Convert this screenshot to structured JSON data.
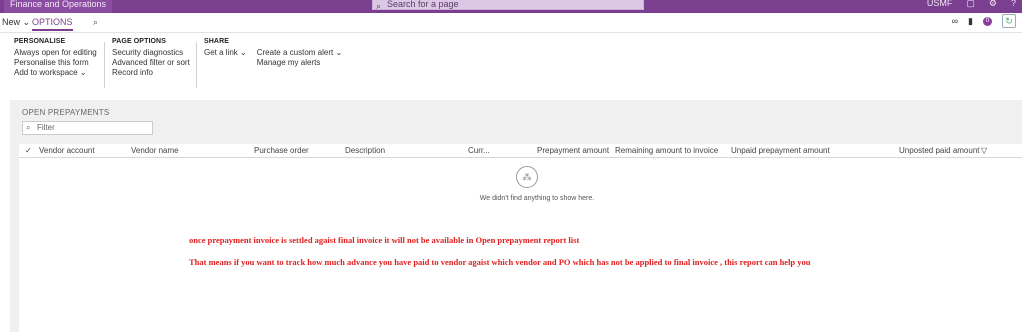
{
  "topbar": {
    "app_title": "Finance and Operations",
    "search_placeholder": "Search for a page",
    "company": "USMF",
    "right_icons": [
      "window-icon",
      "gear-icon",
      "help-icon"
    ]
  },
  "actionbar": {
    "new_label": "New",
    "options_tab": "OPTIONS"
  },
  "ribbon": {
    "personalise": {
      "title": "PERSONALISE",
      "items": [
        "Always open for editing",
        "Personalise this form",
        "Add to workspace"
      ]
    },
    "page_options": {
      "title": "PAGE OPTIONS",
      "items": [
        "Security diagnostics",
        "Advanced filter or sort",
        "Record info"
      ]
    },
    "share": {
      "title": "SHARE",
      "get_link": "Get a link",
      "create_alert": "Create a custom alert",
      "manage_alerts": "Manage my alerts"
    }
  },
  "notification_count": "0",
  "content": {
    "section_title": "OPEN PREPAYMENTS",
    "filter_placeholder": "Filter",
    "columns": [
      "Vendor account",
      "Vendor name",
      "Purchase order",
      "Description",
      "Curr...",
      "Prepayment amount",
      "Remaining amount to invoice",
      "Unpaid prepayment amount",
      "Unposted paid amount"
    ],
    "empty_message": "We didn't find anything to show here."
  },
  "annotations": {
    "line1": "once prepayment invoice is settled agaist final invoice it will not be available in Open prepayment report list",
    "line2": "That means if you want to track how much advance you have paid to vendor agaist which vendor and PO which has not be applied to final invoice , this report can help you"
  },
  "colors": {
    "brand": "#7a3f8f",
    "annotation": "#e02020"
  }
}
